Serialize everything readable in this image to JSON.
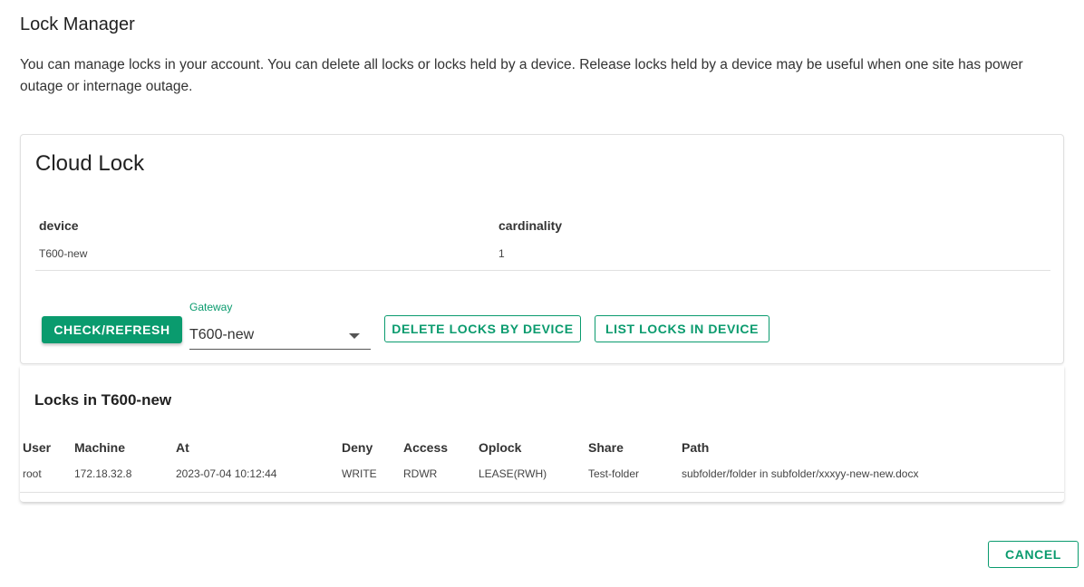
{
  "dialog": {
    "title": "Lock Manager",
    "description": "You can manage locks in your account. You can delete all locks or locks held by a device. Release locks held by a device may be useful when one site has power outage or internage outage."
  },
  "cloud_lock": {
    "title": "Cloud Lock",
    "columns": {
      "device": "device",
      "cardinality": "cardinality"
    },
    "rows": [
      {
        "device": "T600-new",
        "cardinality": "1"
      }
    ]
  },
  "controls": {
    "check_refresh_label": "CHECK/REFRESH",
    "gateway_label": "Gateway",
    "gateway_value": "T600-new",
    "delete_label": "DELETE LOCKS BY DEVICE",
    "list_label": "LIST LOCKS IN DEVICE"
  },
  "locks": {
    "title": "Locks in T600-new",
    "columns": {
      "user": "User",
      "machine": "Machine",
      "at": "At",
      "deny": "Deny",
      "access": "Access",
      "oplock": "Oplock",
      "share": "Share",
      "path": "Path"
    },
    "rows": [
      {
        "user": "root",
        "machine": "172.18.32.8",
        "at": "2023-07-04 10:12:44",
        "deny": "WRITE",
        "access": "RDWR",
        "oplock": "LEASE(RWH)",
        "share": "Test-folder",
        "path": "subfolder/folder in subfolder/xxxyy-new-new.docx"
      }
    ]
  },
  "footer": {
    "cancel_label": "CANCEL"
  },
  "colors": {
    "accent": "#0a9b6e"
  }
}
